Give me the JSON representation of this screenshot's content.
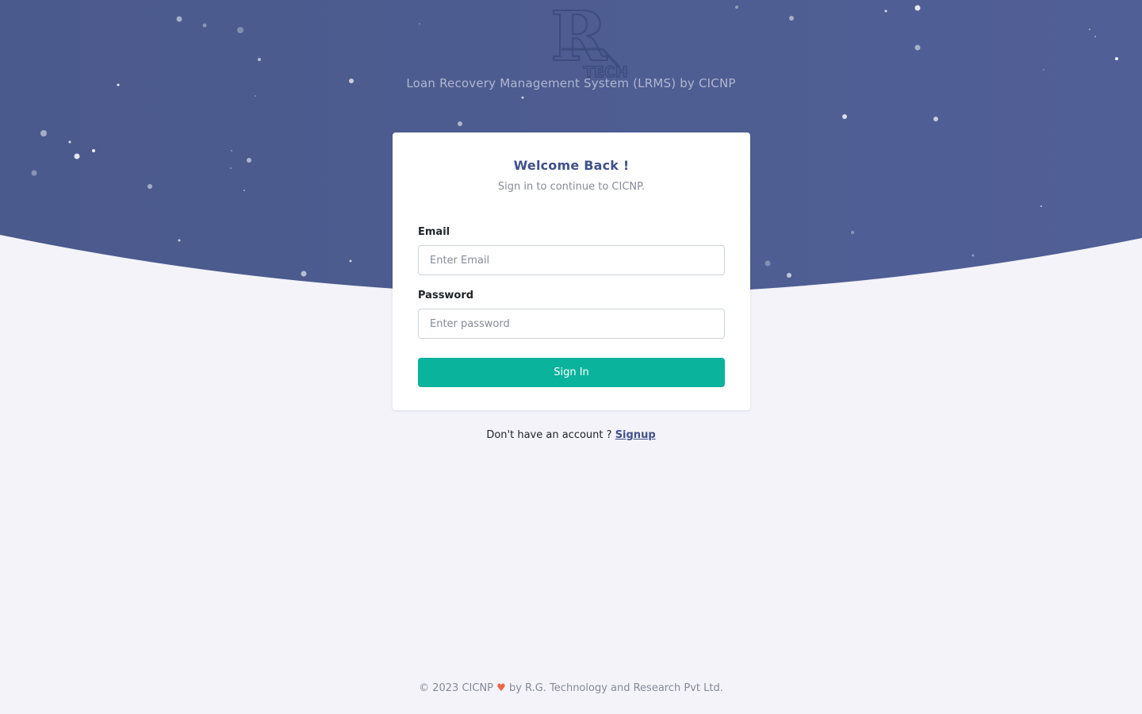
{
  "brand": {
    "logo_icon": "rg-tech-logo-icon",
    "logo_letters": "R",
    "logo_subtext": "TECH",
    "tagline": "Loan Recovery Management System (LRMS) by CICNP"
  },
  "login_card": {
    "title": "Welcome Back !",
    "subtitle": "Sign in to continue to CICNP.",
    "email_label": "Email",
    "email_placeholder": "Enter Email",
    "email_value": "",
    "password_label": "Password",
    "password_placeholder": "Enter password",
    "password_value": "",
    "submit_label": "Sign In"
  },
  "signup_prompt": {
    "text": "Don't have an account ?",
    "link_label": "Signup"
  },
  "footer": {
    "copyright": "© 2023 CICNP",
    "heart_icon": "heart-icon",
    "credit": "by R.G. Technology and Research Pvt Ltd."
  },
  "colors": {
    "hero_background": "#4a5a8f",
    "accent": "#405189",
    "button": "#0ab39c",
    "page_background": "#f3f3f9",
    "heart": "#f06548"
  }
}
